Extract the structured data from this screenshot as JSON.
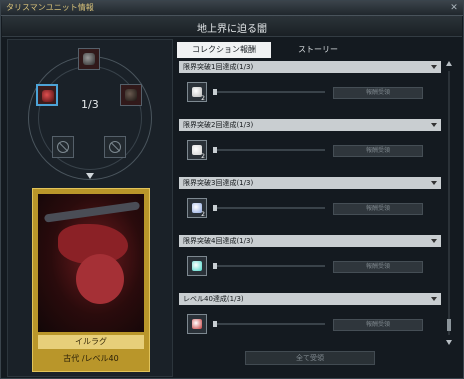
{
  "window": {
    "title": "タリスマンユニット情報",
    "close_label": "✕"
  },
  "subheader": {
    "title": "地上界に迫る闇"
  },
  "unit": {
    "count_text": "1/3",
    "card_name": "イルラグ",
    "card_meta": "古代 /レベル40"
  },
  "tabs": [
    {
      "label": "コレクション報酬",
      "active": true
    },
    {
      "label": "ストーリー",
      "active": false
    }
  ],
  "rewards": [
    {
      "title": "限界突破1回達成(1/3)",
      "qty": "2",
      "button": "報酬受領",
      "icon_color": "#b9b9b9",
      "progress": 0
    },
    {
      "title": "限界突破2回達成(1/3)",
      "qty": "2",
      "button": "報酬受領",
      "icon_color": "#d1d1d1",
      "progress": 0
    },
    {
      "title": "限界突破3回達成(1/3)",
      "qty": "2",
      "button": "報酬受領",
      "icon_color": "#8ea8e0",
      "progress": 0
    },
    {
      "title": "限界突破4回達成(1/3)",
      "qty": "",
      "button": "報酬受領",
      "icon_color": "#49d6c8",
      "progress": 0
    },
    {
      "title": "レベル40達成(1/3)",
      "qty": "",
      "button": "報酬受領",
      "icon_color": "#c33a3a",
      "progress": 0
    }
  ],
  "footer": {
    "all_button": "全て受領"
  }
}
